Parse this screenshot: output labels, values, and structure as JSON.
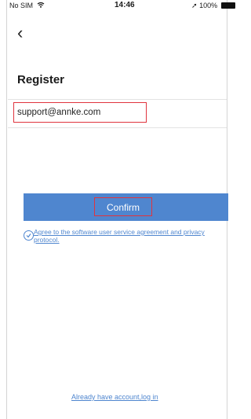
{
  "status_bar": {
    "carrier": "No SIM",
    "time": "14:46",
    "battery": "100%"
  },
  "header": {
    "title": "Register"
  },
  "form": {
    "email_value": "support@annke.com"
  },
  "actions": {
    "confirm_label": "Confirm"
  },
  "agreement": {
    "text": "Agree to the software user service agreement and privacy protocol."
  },
  "footer": {
    "login_link": "Already have account,log in"
  },
  "colors": {
    "accent": "#4f86cf",
    "highlight": "#e0343e"
  }
}
